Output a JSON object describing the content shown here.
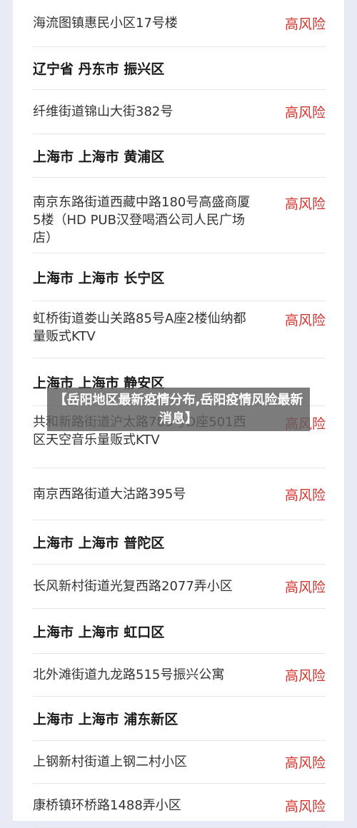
{
  "risk_label": "高风险",
  "colors": {
    "risk": "#d0342c",
    "background": "#e8ebf6",
    "card": "#ffffff"
  },
  "rows": [
    {
      "type": "address",
      "text": "海流图镇惠民小区17号楼",
      "risk": "高风险"
    },
    {
      "type": "region",
      "text": "辽宁省 丹东市 振兴区"
    },
    {
      "type": "address",
      "text": "纤维街道锦山大街382号",
      "risk": "高风险"
    },
    {
      "type": "region",
      "text": "上海市 上海市 黄浦区"
    },
    {
      "type": "address",
      "text": "南京东路街道西藏中路180号高盛商厦5楼（HD PUB汉登喝酒公司人民广场店）",
      "risk": "高风险"
    },
    {
      "type": "region",
      "text": "上海市 上海市 长宁区"
    },
    {
      "type": "address",
      "text": "虹桥街道娄山关路85号A座2楼仙纳都量贩式KTV",
      "risk": "高风险"
    },
    {
      "type": "region",
      "text": "上海市 上海市 静安区"
    },
    {
      "type": "address",
      "text": "共和新路街道沪太路785号D座501西区天空音乐量贩式KTV",
      "risk": "高风险"
    },
    {
      "type": "address",
      "text": "南京西路街道大沽路395号",
      "risk": "高风险"
    },
    {
      "type": "region",
      "text": "上海市 上海市 普陀区"
    },
    {
      "type": "address",
      "text": "长风新村街道光复西路2077弄小区",
      "risk": "高风险"
    },
    {
      "type": "region",
      "text": "上海市 上海市 虹口区"
    },
    {
      "type": "address",
      "text": "北外滩街道九龙路515号振兴公寓",
      "risk": "高风险"
    },
    {
      "type": "region",
      "text": "上海市 上海市 浦东新区"
    },
    {
      "type": "address",
      "text": "上钢新村街道上钢二村小区",
      "risk": "高风险"
    },
    {
      "type": "address",
      "text": "康桥镇环桥路1488弄小区",
      "risk": "高风险"
    }
  ],
  "overlay_title": "【岳阳地区最新疫情分布,岳阳疫情风险最新消息】"
}
